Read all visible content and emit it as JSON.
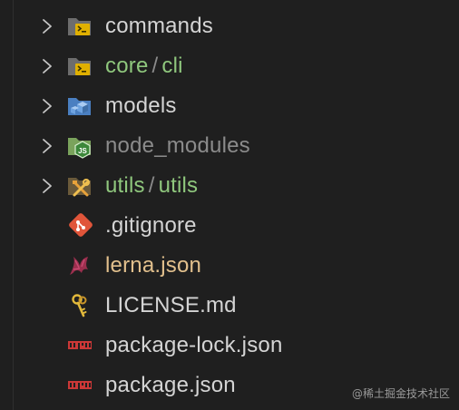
{
  "explorer": {
    "rows": [
      {
        "label": "commands",
        "type": "folder",
        "expanded": false,
        "icon": "terminal-folder-icon"
      },
      {
        "label_parts": [
          "core",
          "cli"
        ],
        "separator": "/",
        "type": "folder",
        "expanded": false,
        "icon": "terminal-folder-icon"
      },
      {
        "label": "models",
        "type": "folder",
        "expanded": false,
        "icon": "models-folder-icon"
      },
      {
        "label": "node_modules",
        "type": "folder",
        "expanded": false,
        "icon": "node-folder-icon"
      },
      {
        "label_parts": [
          "utils",
          "utils"
        ],
        "separator": "/",
        "type": "folder",
        "expanded": false,
        "icon": "tools-folder-icon"
      },
      {
        "label": ".gitignore",
        "type": "file",
        "icon": "git-icon"
      },
      {
        "label": "lerna.json",
        "type": "file",
        "icon": "lerna-icon"
      },
      {
        "label": "LICENSE.md",
        "type": "file",
        "icon": "license-key-icon"
      },
      {
        "label": "package-lock.json",
        "type": "file",
        "icon": "npm-icon"
      },
      {
        "label": "package.json",
        "type": "file",
        "icon": "npm-icon"
      }
    ]
  },
  "colors": {
    "background": "#1f1f1f",
    "text_default": "#d4d4d4",
    "text_green": "#8fc77d",
    "text_dim": "#8b8b8b",
    "text_modified": "#e2c08d"
  },
  "watermark": "@稀土掘金技术社区"
}
